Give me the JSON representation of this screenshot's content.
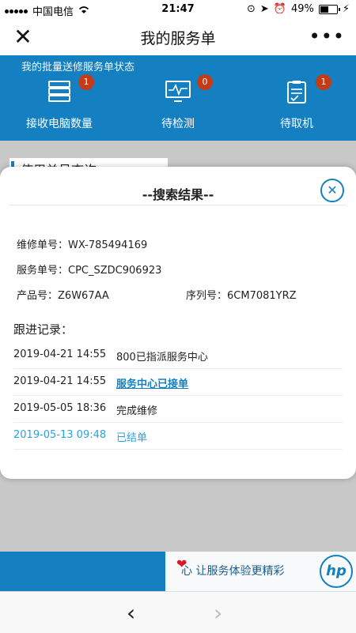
{
  "status_bar": {
    "carrier": "中国电信",
    "time": "21:47",
    "battery": "49%",
    "battery_level": 0.49
  },
  "nav": {
    "title": "我的服务单",
    "close_icon": "close-icon",
    "more_icon": "more-icon"
  },
  "banner": {
    "subtitle": "我的批量送修服务单状态",
    "stats": [
      {
        "label": "接收电脑数量",
        "count": "1",
        "icon": "server-icon"
      },
      {
        "label": "待检测",
        "count": "0",
        "icon": "monitor-icon"
      },
      {
        "label": "待取机",
        "count": "1",
        "icon": "clipboard-icon"
      }
    ]
  },
  "background_section": {
    "title": "使用单号查询"
  },
  "modal": {
    "title": "--搜索结果--",
    "repair_order_label": "维修单号：",
    "repair_order_value": "WX-785494169",
    "service_order_label": "服务单号：",
    "service_order_value": "CPC_SZDC906923",
    "product_label": "产品号：",
    "product_value": "Z6W67AA",
    "serial_label": "序列号：",
    "serial_value": "6CM7081YRZ",
    "records_title": "跟进记录：",
    "records": [
      {
        "date": "2019-04-21 14:55",
        "status": "800已指派服务中心"
      },
      {
        "date": "2019-04-21 14:55",
        "status": "服务中心已接单"
      },
      {
        "date": "2019-05-05 18:36",
        "status": "完成维修"
      },
      {
        "date": "2019-05-13 09:48",
        "status": "已结单"
      }
    ]
  },
  "footer": {
    "slogan": "心 让服务体验更精彩",
    "logo": "hp"
  },
  "toolbar": {
    "back_icon": "chevron-left-icon",
    "forward_icon": "chevron-right-icon"
  },
  "colors": {
    "brand": "#1580c1",
    "badge": "#c43b17",
    "link": "#1580c1",
    "highlight": "#27a2dc"
  }
}
